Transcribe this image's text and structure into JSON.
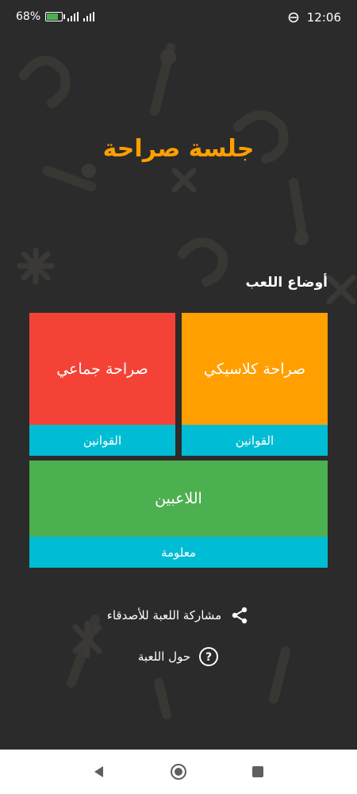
{
  "status_bar": {
    "battery": "68%",
    "time": "12:06"
  },
  "app": {
    "title": "جلسة صراحة"
  },
  "modes": {
    "label": "أوضاع اللعب",
    "classic": {
      "title": "صراحة كلاسيكي",
      "footer": "القوانين"
    },
    "group": {
      "title": "صراحة جماعي",
      "footer": "القوانين"
    },
    "players": {
      "title": "اللاعبين",
      "footer": "معلومة"
    }
  },
  "links": {
    "share": "مشاركة اللعبة للأصدقاء",
    "about": "حول اللعبة"
  },
  "colors": {
    "background": "#2b2b2b",
    "title": "#ff9f00",
    "classic": "#ff9f00",
    "group": "#f44336",
    "players": "#4caf50",
    "footer": "#00bcd4"
  },
  "icons": {
    "share": "share-icon",
    "about": "help-circle-icon",
    "nav_back": "back-triangle-icon",
    "nav_home": "home-circle-icon",
    "nav_recents": "recents-square-icon"
  }
}
